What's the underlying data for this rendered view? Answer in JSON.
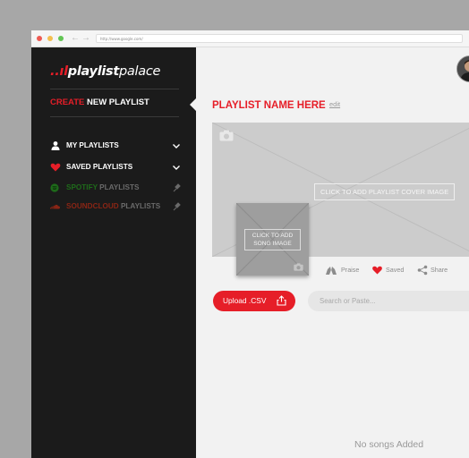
{
  "browser": {
    "url": "http://www.google.com/",
    "buttons": [
      "close",
      "minimize",
      "maximize"
    ],
    "colors": {
      "close": "#ee5a52",
      "minimize": "#f4bf4f",
      "maximize": "#62c554"
    }
  },
  "sidebar": {
    "logo": {
      "mark": "..ıl",
      "word_bold": "playlist",
      "word_light": "palace"
    },
    "create": {
      "red": "CREATE",
      "white": "NEW PLAYLIST"
    },
    "items": [
      {
        "label": "MY PLAYLISTS",
        "icon": "user-icon",
        "action": "chevron-down-icon",
        "color": "#ffffff"
      },
      {
        "label": "SAVED PLAYLISTS",
        "icon": "heart-icon",
        "action": "chevron-down-icon",
        "color": "#ffffff"
      },
      {
        "label_brand": "SPOTIFY",
        "label_rest": "PLAYLISTS",
        "icon": "spotify-icon",
        "action": "pin-icon",
        "brand_color": "#1e6b1a"
      },
      {
        "label_brand": "SOUNDCLOUD",
        "label_rest": "PLAYLISTS",
        "icon": "soundcloud-icon",
        "action": "pin-icon",
        "brand_color": "#8a2515"
      }
    ]
  },
  "main": {
    "title": "PLAYLIST NAME HERE",
    "edit_label": "edit",
    "cover_button": "CLICK TO ADD PLAYLIST COVER IMAGE",
    "song_button_line1": "CLICK TO ADD",
    "song_button_line2": "SONG IMAGE",
    "actions": {
      "praise": "Praise",
      "saved": "Saved",
      "share": "Share"
    },
    "upload_label": "Upload .CSV",
    "search_placeholder": "Search or Paste...",
    "empty_text": "No songs Added"
  },
  "colors": {
    "accent": "#e61e28",
    "sidebar_bg": "#1b1b1b",
    "main_bg": "#f2f2f2"
  }
}
